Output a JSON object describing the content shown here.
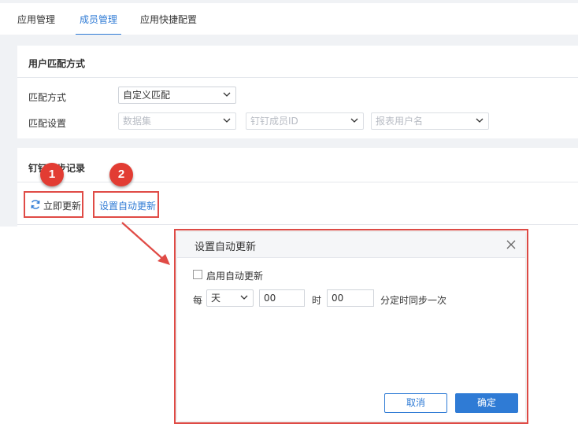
{
  "tabs": [
    {
      "label": "应用管理",
      "active": false
    },
    {
      "label": "成员管理",
      "active": true
    },
    {
      "label": "应用快捷配置",
      "active": false
    }
  ],
  "match_section": {
    "title": "用户匹配方式",
    "mode_label": "匹配方式",
    "mode_value": "自定义匹配",
    "settings_label": "匹配设置",
    "dataset_placeholder": "数据集",
    "member_id_placeholder": "钉钉成员ID",
    "report_user_placeholder": "报表用户名"
  },
  "sync_section": {
    "title": "钉钉同步记录",
    "refresh_label": "立即更新",
    "auto_update_label": "设置自动更新"
  },
  "badges": [
    "1",
    "2"
  ],
  "dialog": {
    "title": "设置自动更新",
    "enable_label": "启用自动更新",
    "every_label": "每",
    "period_value": "天",
    "hour_value": "00",
    "hour_label": "时",
    "minute_value": "00",
    "suffix_label": "分定时同步一次",
    "cancel_label": "取消",
    "ok_label": "确定"
  },
  "colors": {
    "accent": "#2f7bd5",
    "highlight": "#e04b46",
    "badge": "#e23c33"
  }
}
